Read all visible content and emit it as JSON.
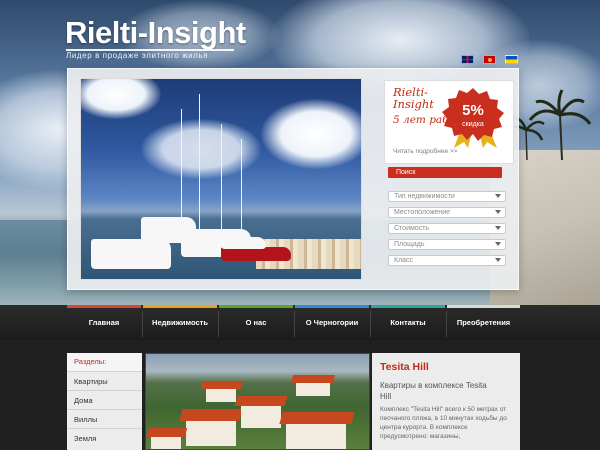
{
  "site": {
    "logo": "Rielti-Insight",
    "tagline": "Лидер в продаже элитного жилья"
  },
  "languages": [
    {
      "code": "en",
      "icon": "uk-flag-icon"
    },
    {
      "code": "me",
      "icon": "montenegro-flag-icon"
    },
    {
      "code": "ua",
      "icon": "ukraine-flag-icon"
    }
  ],
  "promo": {
    "title": "Rielti-Insight",
    "years": "5 лет работы",
    "badge_value": "5%",
    "badge_label": "скидка",
    "read_more": "Читать подробнее >>"
  },
  "search": {
    "button_label": "Поиск",
    "selects": [
      {
        "value": "Тип недвижимости"
      },
      {
        "value": "Местоположение"
      },
      {
        "value": "Стоимость"
      },
      {
        "value": "Площадь"
      },
      {
        "value": "Класс"
      }
    ]
  },
  "nav": {
    "items": [
      {
        "label": "Главная",
        "color": "#d8472a"
      },
      {
        "label": "Недвижимость",
        "color": "#e6a21a"
      },
      {
        "label": "О нас",
        "color": "#5aa62c"
      },
      {
        "label": "О Черногории",
        "color": "#2f8ad8"
      },
      {
        "label": "Контакты",
        "color": "#2aa89a"
      },
      {
        "label": "Преобретения",
        "color": "#d9d9d9"
      }
    ]
  },
  "sidebar": {
    "heading": "Разделы:",
    "items": [
      "Квартиры",
      "Дома",
      "Виллы",
      "Земля"
    ]
  },
  "featured": {
    "title": "Tesita Hill",
    "subtitle": "Квартиры в комплексе Tesita Hill",
    "description": "Комплекс \"Tesita Hill\" всего к 50 метрах от песчаного пляжа, в 10 минутах ходьбы до центра курорта. В комплексе предусмотрено: магазины,"
  },
  "colors": {
    "accent": "#c62a12",
    "search_button": "#c92f1f"
  }
}
